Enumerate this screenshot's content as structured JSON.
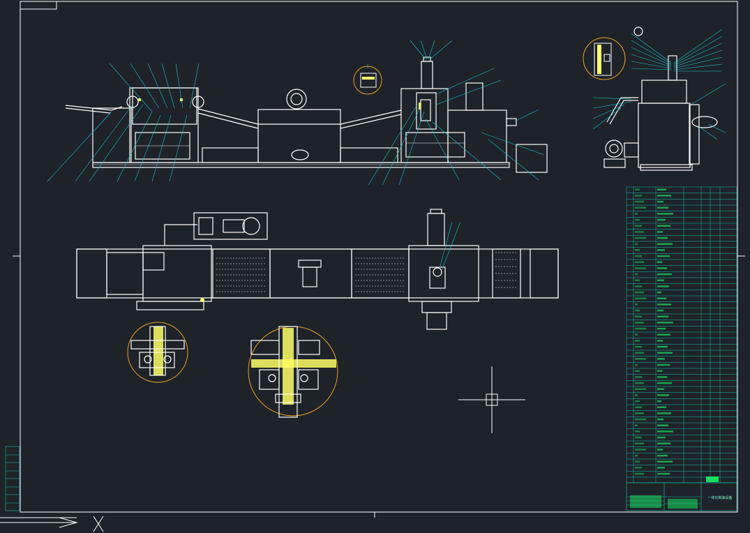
{
  "drawing": {
    "title_caption": "一体化制油设备",
    "crosshair_label": "",
    "colors": {
      "background": "#1e2329",
      "outline": "#ffffff",
      "leader": "#18c8d0",
      "hatch": "#ffff66",
      "table_line": "#18c0b0",
      "table_text": "#18e060",
      "detail_circle": "#f0a020"
    },
    "views": [
      "front-elevation",
      "side-elevation",
      "plan-view",
      "detail-a",
      "detail-b",
      "detail-c"
    ]
  }
}
